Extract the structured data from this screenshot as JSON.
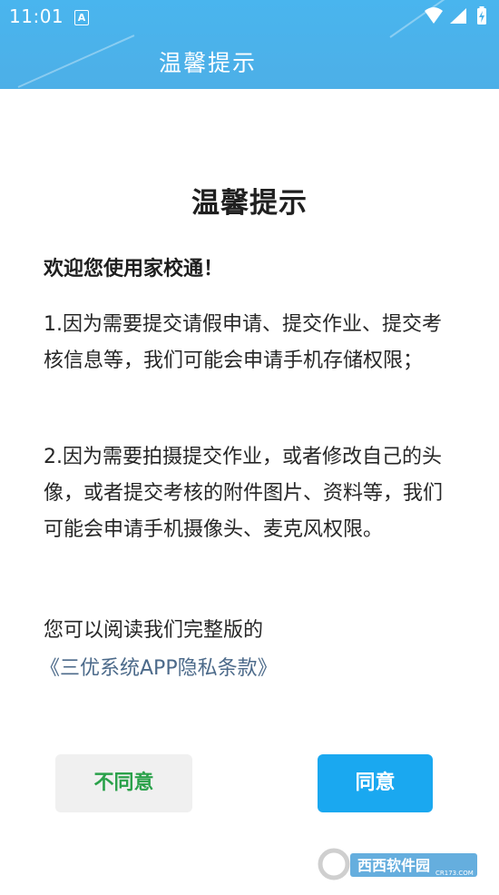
{
  "status_bar": {
    "time": "11:01",
    "notification_icon_letter": "A"
  },
  "app_bar": {
    "title": "温馨提示"
  },
  "dialog": {
    "title": "温馨提示",
    "welcome": "欢迎您使用家校通！",
    "paragraph_1": "1.因为需要提交请假申请、提交作业、提交考核信息等，我们可能会申请手机存储权限；",
    "paragraph_2": "2.因为需要拍摄提交作业，或者修改自己的头像，或者提交考核的附件图片、资料等，我们可能会申请手机摄像头、麦克风权限。",
    "read_prefix": "您可以阅读我们完整版的",
    "privacy_link": "《三优系统APP隐私条款》"
  },
  "buttons": {
    "disagree": "不同意",
    "agree": "同意"
  },
  "watermark": {
    "text": "西西软件园",
    "subtext": "CR173.COM"
  },
  "colors": {
    "app_bar": "#4ab2eb",
    "agree_button": "#1aa8f0",
    "disagree_text": "#2aa14a",
    "link": "#4c6a8a"
  }
}
